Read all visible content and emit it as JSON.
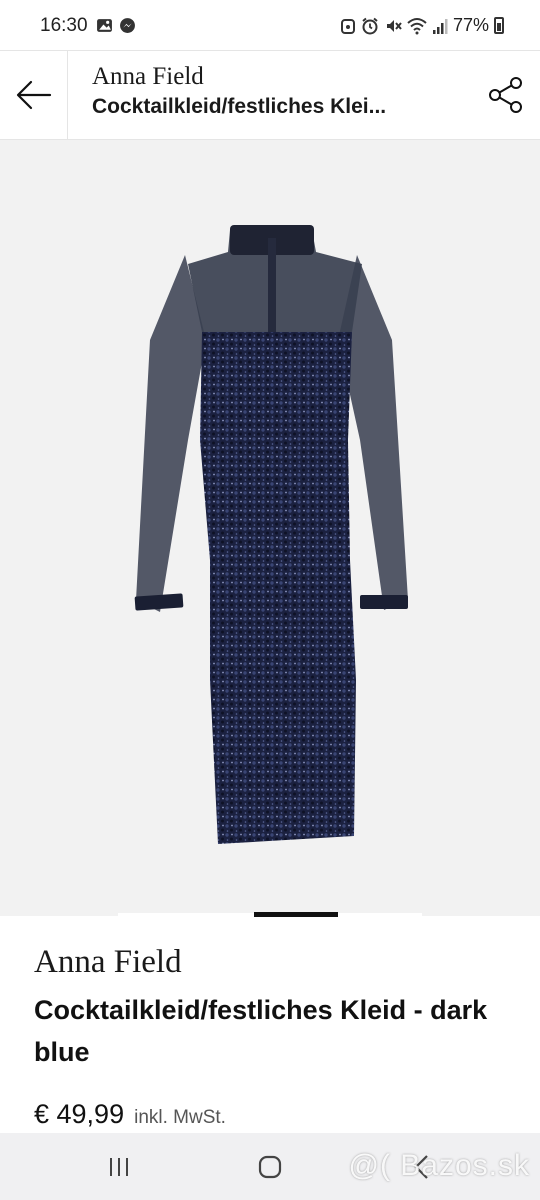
{
  "status_bar": {
    "time": "16:30",
    "battery": "77%",
    "left_icons": [
      "gallery-icon",
      "messenger-icon"
    ],
    "right_icons": [
      "alarm-icon",
      "mute-icon",
      "wifi-icon",
      "signal-icon",
      "battery-icon"
    ]
  },
  "header": {
    "brand": "Anna Field",
    "title": "Cocktailkleid/festliches Klei...",
    "back_icon": "arrow-left-icon",
    "share_icon": "share-icon"
  },
  "gallery": {
    "image_subject": "navy sequin dress with sheer mesh sleeves",
    "active_index": 2,
    "total": 4,
    "wishlist_icon": "heart-icon",
    "cart_icon": "shopping-bag-icon"
  },
  "product": {
    "brand": "Anna Field",
    "name": "Cocktailkleid/festliches Kleid - dark blue",
    "price": "€ 49,99",
    "tax_note": "inkl. MwSt."
  },
  "nav": {
    "recent_icon": "recent-apps-icon",
    "home_icon": "home-icon",
    "back_icon": "back-icon",
    "watermark": "@( Bazos.sk"
  },
  "colors": {
    "dress": "#1c2240",
    "image_bg": "#f2f2f2",
    "cart_bg": "#111111",
    "nav_bg": "#f0f0f2"
  }
}
